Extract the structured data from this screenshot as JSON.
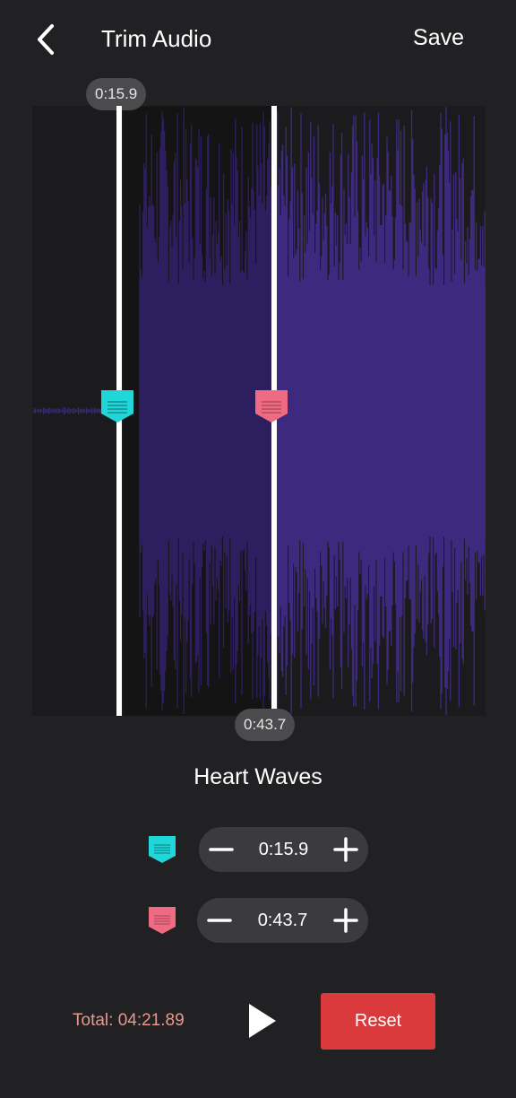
{
  "header": {
    "title": "Trim Audio",
    "save_label": "Save"
  },
  "waveform": {
    "start_label": "0:15.9",
    "end_label": "0:43.7",
    "colors": {
      "wave": "#3d2a7f",
      "background": "#1b1b1d",
      "start_marker": "#20d6d8",
      "end_marker": "#ee6b83"
    }
  },
  "track": {
    "name": "Heart Waves"
  },
  "start_control": {
    "value": "0:15.9",
    "minus_icon": "minus-icon",
    "plus_icon": "plus-icon"
  },
  "end_control": {
    "value": "0:43.7",
    "minus_icon": "minus-icon",
    "plus_icon": "plus-icon"
  },
  "footer": {
    "total": "Total: 04:21.89",
    "reset_label": "Reset",
    "play_icon": "play-icon"
  },
  "colors": {
    "accent": "#da3a3c",
    "total_text": "#e89a8e",
    "page_bg": "#212023"
  }
}
